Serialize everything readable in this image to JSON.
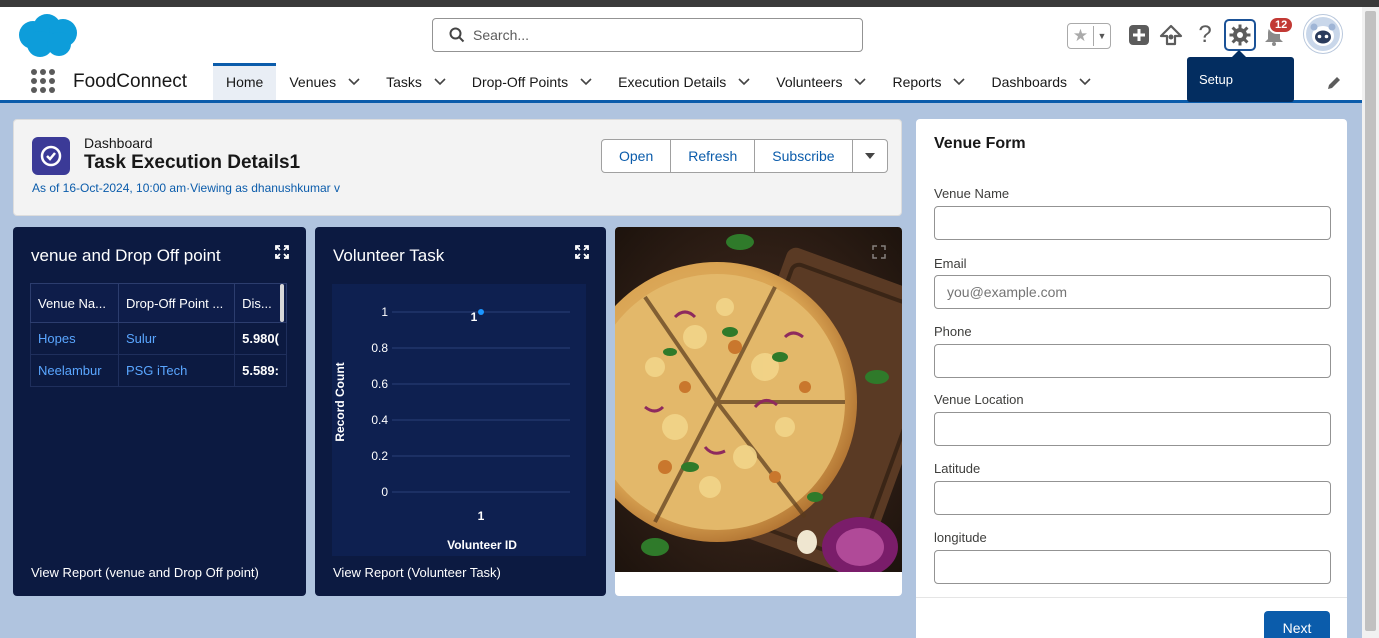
{
  "header": {
    "search_placeholder": "Search...",
    "notification_count": "12",
    "tooltip": "Setup"
  },
  "nav": {
    "app_name": "FoodConnect",
    "tabs": [
      {
        "label": "Home",
        "has_menu": false
      },
      {
        "label": "Venues",
        "has_menu": true
      },
      {
        "label": "Tasks",
        "has_menu": true
      },
      {
        "label": "Drop-Off Points",
        "has_menu": true
      },
      {
        "label": "Execution Details",
        "has_menu": true
      },
      {
        "label": "Volunteers",
        "has_menu": true
      },
      {
        "label": "Reports",
        "has_menu": true
      },
      {
        "label": "Dashboards",
        "has_menu": true
      }
    ]
  },
  "dashboard": {
    "type_label": "Dashboard",
    "title": "Task Execution Details1",
    "subtitle": "As of 16-Oct-2024, 10:00 am·Viewing as dhanushkumar v",
    "buttons": {
      "open": "Open",
      "refresh": "Refresh",
      "subscribe": "Subscribe"
    }
  },
  "card_table": {
    "title": "venue and Drop Off point",
    "columns": [
      "Venue Na...",
      "Drop-Off Point ...",
      "Dis..."
    ],
    "rows": [
      [
        "Hopes",
        "Sulur",
        "5.980("
      ],
      [
        "Neelambur",
        "PSG iTech",
        "5.589:"
      ]
    ],
    "footer": "View Report (venue and Drop Off point)"
  },
  "card_chart": {
    "title": "Volunteer Task",
    "footer": "View Report (Volunteer Task)"
  },
  "chart_data": {
    "type": "scatter",
    "title": "",
    "xlabel": "Volunteer ID",
    "ylabel": "Record Count",
    "categories": [
      "1"
    ],
    "values": [
      1
    ],
    "y_ticks": [
      "1",
      "0.8",
      "0.6",
      "0.4",
      "0.2",
      "0"
    ],
    "ylim": [
      0,
      1
    ],
    "data_labels": [
      "1"
    ],
    "color": "#1b96ff"
  },
  "venue_form": {
    "title": "Venue Form",
    "fields": [
      {
        "label": "Venue Name",
        "placeholder": ""
      },
      {
        "label": "Email",
        "placeholder": "you@example.com"
      },
      {
        "label": "Phone",
        "placeholder": ""
      },
      {
        "label": "Venue Location",
        "placeholder": ""
      },
      {
        "label": "Latitude",
        "placeholder": ""
      },
      {
        "label": "longitude",
        "placeholder": ""
      }
    ],
    "next_label": "Next"
  }
}
